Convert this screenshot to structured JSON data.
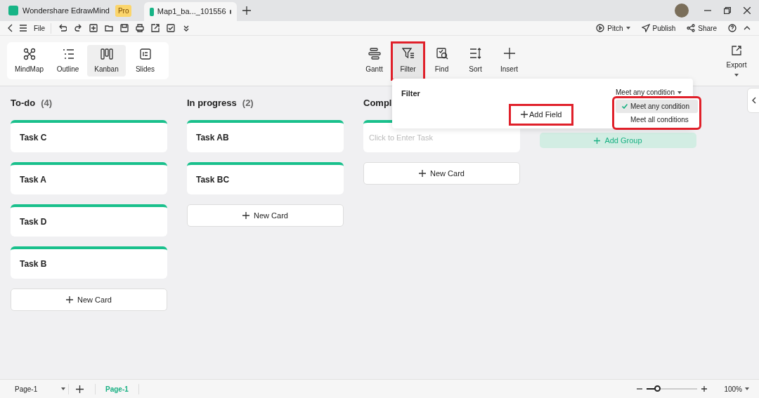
{
  "app": {
    "name": "Wondershare EdrawMind",
    "badge": "Pro"
  },
  "tabs": [
    {
      "label": "Map1_ba..._101556",
      "selected": true,
      "unsaved": true
    }
  ],
  "menu": {
    "file": "File"
  },
  "top_actions": [
    {
      "kind": "pitch",
      "label": "Pitch",
      "dropdown": true
    },
    {
      "kind": "publish",
      "label": "Publish",
      "dropdown": false
    },
    {
      "kind": "share",
      "label": "Share",
      "dropdown": false
    }
  ],
  "views": [
    {
      "kind": "mindmap",
      "label": "MindMap",
      "selected": false
    },
    {
      "kind": "outline",
      "label": "Outline",
      "selected": false
    },
    {
      "kind": "kanban",
      "label": "Kanban",
      "selected": true
    },
    {
      "kind": "slides",
      "label": "Slides",
      "selected": false
    }
  ],
  "tools": [
    {
      "kind": "gantt",
      "label": "Gantt",
      "selected": false
    },
    {
      "kind": "filter",
      "label": "Filter",
      "selected": true
    },
    {
      "kind": "find",
      "label": "Find",
      "selected": false
    },
    {
      "kind": "sort",
      "label": "Sort",
      "selected": false
    },
    {
      "kind": "insert",
      "label": "Insert",
      "selected": false
    }
  ],
  "export": {
    "label": "Export"
  },
  "columns": [
    {
      "title": "To-do",
      "count": "(4)",
      "cards": [
        "Task C",
        "Task A",
        "Task D",
        "Task B"
      ],
      "new_card": "New Card"
    },
    {
      "title": "In progress",
      "count": "(2)",
      "cards": [
        "Task AB",
        "Task BC"
      ],
      "new_card": "New Card"
    },
    {
      "title": "Compl",
      "task_placeholder": "Click to Enter Task",
      "new_card": "New Card"
    }
  ],
  "add_group": "Add Group",
  "filter_popup": {
    "title": "Filter",
    "add_field": "Add Field",
    "condition": "Meet any condition",
    "options": [
      {
        "label": "Meet any condition",
        "selected": true
      },
      {
        "label": "Meet all conditions",
        "selected": false
      }
    ]
  },
  "status_bar": {
    "page_select": "Page-1",
    "page_tab": "Page-1",
    "zoom": "100%",
    "level": 0.2
  }
}
